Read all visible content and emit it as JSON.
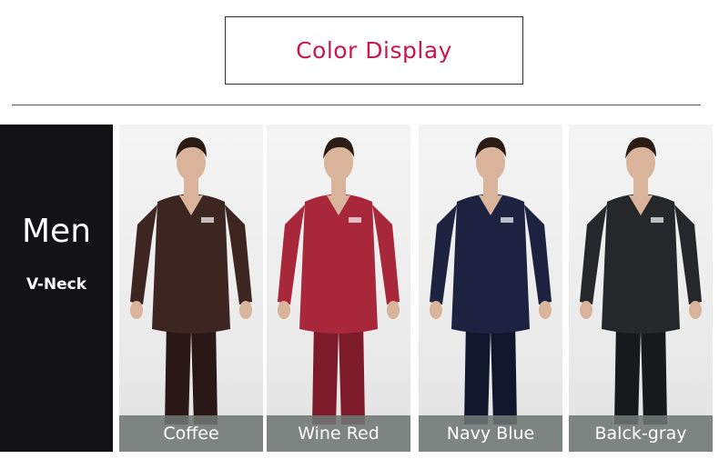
{
  "header": {
    "title": "Color Display"
  },
  "side_panel": {
    "gender": "Men",
    "neckline": "V-Neck"
  },
  "products": [
    {
      "label": "Coffee",
      "color": "#3d2521",
      "color_dark": "#2a1816"
    },
    {
      "label": "Wine Red",
      "color": "#a8273a",
      "color_dark": "#7e1b2b"
    },
    {
      "label": "Navy Blue",
      "color": "#1c2240",
      "color_dark": "#12162c"
    },
    {
      "label": "Balck-gray",
      "color": "#26272a",
      "color_dark": "#18191b"
    }
  ],
  "colors": {
    "title_accent": "#c8174d",
    "side_panel_bg": "#131316",
    "label_bar": "#6e7674"
  }
}
